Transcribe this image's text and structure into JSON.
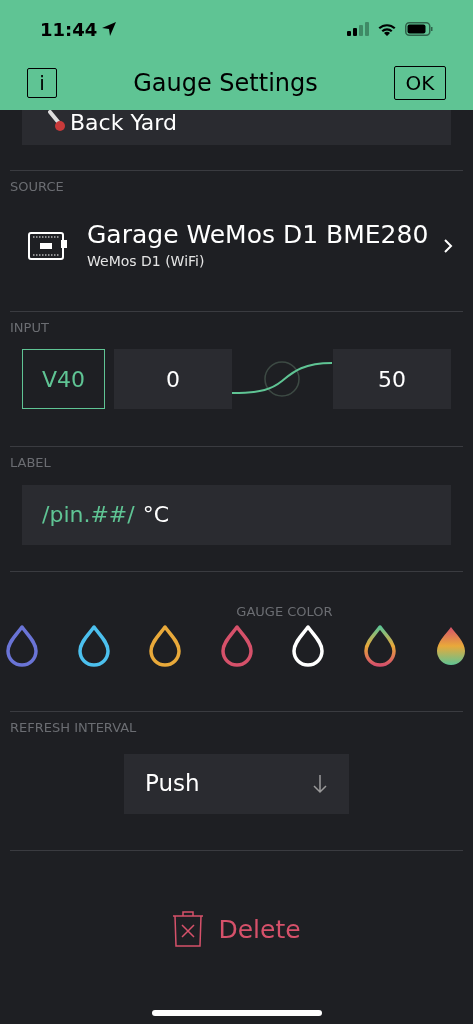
{
  "status_bar": {
    "time": "11:44"
  },
  "header": {
    "info_button": "i",
    "title": "Gauge Settings",
    "ok_button": "OK"
  },
  "name_field": {
    "value": "Back Yard"
  },
  "source": {
    "label": "SOURCE",
    "device_name": "Garage WeMos D1 BME280",
    "device_type": "WeMos D1 (WiFi)"
  },
  "input": {
    "label": "INPUT",
    "pin": "V40",
    "min": "0",
    "max": "50"
  },
  "label_section": {
    "label": "LABEL",
    "value_pin": "/pin.##/",
    "value_unit": "°C"
  },
  "gauge_color": {
    "label": "GAUGE COLOR",
    "swatches": [
      {
        "kind": "solid",
        "color": "#6a74d6",
        "selected": false
      },
      {
        "kind": "solid",
        "color": "#4cc0ee",
        "selected": false
      },
      {
        "kind": "solid",
        "color": "#e9a93a",
        "selected": false
      },
      {
        "kind": "solid",
        "color": "#d6516a",
        "selected": false
      },
      {
        "kind": "solid",
        "color": "#ffffff",
        "selected": false
      },
      {
        "kind": "gradient",
        "selected": false
      },
      {
        "kind": "gradient",
        "selected": true
      }
    ]
  },
  "refresh_interval": {
    "label": "REFRESH INTERVAL",
    "value": "Push"
  },
  "delete_button": "Delete"
}
